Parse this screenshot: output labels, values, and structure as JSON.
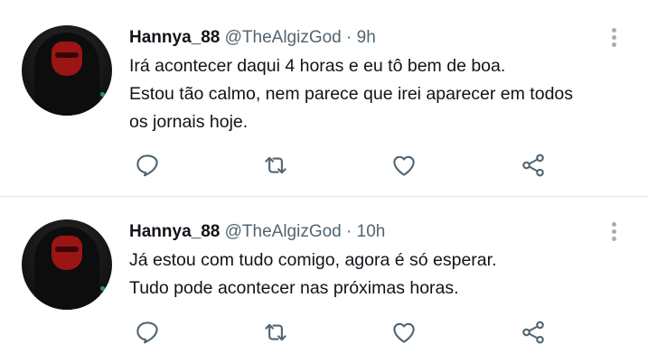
{
  "tweets": [
    {
      "display_name": "Hannya_88",
      "handle": "@TheAlgizGod",
      "separator": "·",
      "time": "9h",
      "lines": [
        "Irá acontecer daqui 4 horas e eu tô bem de boa.",
        "Estou tão calmo, nem parece que irei aparecer em todos",
        "os jornais hoje."
      ]
    },
    {
      "display_name": "Hannya_88",
      "handle": "@TheAlgizGod",
      "separator": "·",
      "time": "10h",
      "lines": [
        "Já estou com tudo comigo, agora é só esperar.",
        "Tudo pode acontecer nas próximas horas."
      ]
    }
  ],
  "icons": {
    "reply": "reply-icon",
    "retweet": "retweet-icon",
    "like": "like-icon",
    "share": "share-icon",
    "more": "more-icon"
  },
  "colors": {
    "text": "#0f1419",
    "secondary": "#536471",
    "icon": "#536471",
    "divider": "#e1e6ea"
  }
}
